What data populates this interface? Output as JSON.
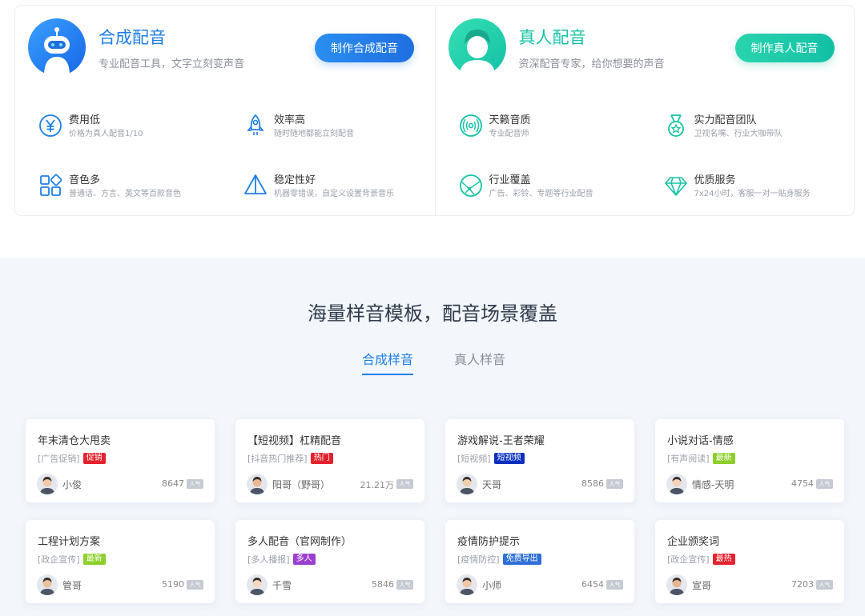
{
  "synthetic": {
    "title": "合成配音",
    "subtitle": "专业配音工具，文字立刻变声音",
    "button": "制作合成配音",
    "features": [
      {
        "icon": "yen-icon",
        "title": "费用低",
        "desc": "价格为真人配音1/10"
      },
      {
        "icon": "rocket-icon",
        "title": "效率高",
        "desc": "随时随地都能立刻配音"
      },
      {
        "icon": "grid-icon",
        "title": "音色多",
        "desc": "普通话、方言、英文等百款音色"
      },
      {
        "icon": "triangle-icon",
        "title": "稳定性好",
        "desc": "机器零错误，自定义设置背景音乐"
      }
    ]
  },
  "human": {
    "title": "真人配音",
    "subtitle": "资深配音专家，给你想要的声音",
    "button": "制作真人配音",
    "features": [
      {
        "icon": "sound-icon",
        "title": "天籁音质",
        "desc": "专业配音师"
      },
      {
        "icon": "medal-icon",
        "title": "实力配音团队",
        "desc": "卫视名嘴、行业大咖带队"
      },
      {
        "icon": "globe-icon",
        "title": "行业覆盖",
        "desc": "广告、彩铃、专题等行业配音"
      },
      {
        "icon": "diamond-icon",
        "title": "优质服务",
        "desc": "7x24小时，客服一对一贴身服务"
      }
    ]
  },
  "samples": {
    "title": "海量样音模板，配音场景覆盖",
    "tabs": [
      {
        "label": "合成样音",
        "active": true
      },
      {
        "label": "真人样音",
        "active": false
      }
    ],
    "popularity_label": "人气",
    "cards": [
      {
        "title": "年末清仓大甩卖",
        "tag": "[广告促销]",
        "badge": "促销",
        "badge_color": "#e5212d",
        "author": "小俊",
        "count": "8647"
      },
      {
        "title": "【短视频】杠精配音",
        "tag": "[抖音热门推荐]",
        "badge": "热门",
        "badge_color": "#e5212d",
        "author": "阳哥（野哥）",
        "count": "21.21万"
      },
      {
        "title": "游戏解说-王者荣耀",
        "tag": "[短视频]",
        "badge": "短视频",
        "badge_color": "#0a2fbf",
        "author": "天哥",
        "count": "8586"
      },
      {
        "title": "小说对话-情感",
        "tag": "[有声阅读]",
        "badge": "最新",
        "badge_color": "#8ccf2b",
        "author": "情感-天明",
        "count": "4754"
      },
      {
        "title": "工程计划方案",
        "tag": "[政企宣传]",
        "badge": "最新",
        "badge_color": "#8ccf2b",
        "author": "管哥",
        "count": "5190"
      },
      {
        "title": "多人配音（官网制作）",
        "tag": "[多人播报]",
        "badge": "多人",
        "badge_color": "#9b3fd1",
        "author": "千雪",
        "count": "5846"
      },
      {
        "title": "疫情防护提示",
        "tag": "[疫情防控]",
        "badge": "免费导出",
        "badge_color": "#2f6fd8",
        "author": "小师",
        "count": "6454"
      },
      {
        "title": "企业颁奖词",
        "tag": "[政企宣传]",
        "badge": "最热",
        "badge_color": "#e5212d",
        "author": "宣哥",
        "count": "7203"
      }
    ]
  },
  "colors": {
    "accent_blue": "#1f7fe6",
    "accent_green": "#1fc8a8",
    "badge_red": "#e5212d"
  }
}
